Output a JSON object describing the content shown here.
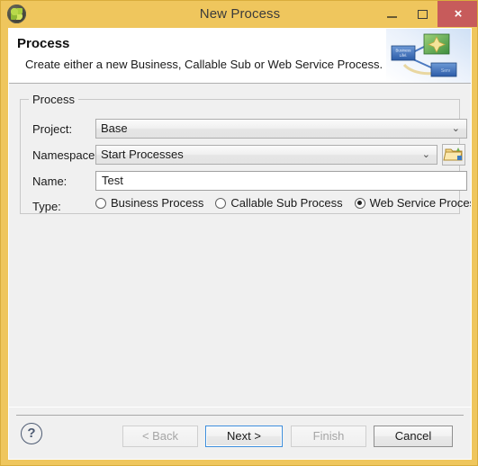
{
  "window": {
    "title": "New Process",
    "app_icon": "globe-clover-icon",
    "accent_border": "#efc65d",
    "close_button_color": "#c75b5b",
    "controls": {
      "minimize": "minimize-icon",
      "maximize": "maximize-icon",
      "close": "close-icon",
      "close_glyph": "×"
    }
  },
  "header": {
    "title": "Process",
    "subtitle": "Create either a new Business, Callable Sub or Web Service Process.",
    "banner_icon": "process-diagram-banner"
  },
  "form": {
    "group_legend": "Process",
    "fields": {
      "project": {
        "label": "Project:",
        "value": "Base",
        "chevron": "⌄",
        "type": "combobox"
      },
      "namespace": {
        "label": "Namespace:",
        "value": "Start Processes",
        "chevron": "⌄",
        "type": "combobox",
        "browse_icon": "folder-browse-icon"
      },
      "name": {
        "label": "Name:",
        "value": "Test",
        "placeholder": "",
        "type": "textfield"
      },
      "type": {
        "label": "Type:",
        "options": [
          {
            "label": "Business Process",
            "selected": false
          },
          {
            "label": "Callable Sub Process",
            "selected": false
          },
          {
            "label": "Web Service Process",
            "selected": true
          }
        ]
      }
    }
  },
  "footer": {
    "help_glyph": "?",
    "help_name": "help-button",
    "buttons": [
      {
        "label": "< Back",
        "state": "disabled",
        "name": "back-button"
      },
      {
        "label": "Next >",
        "state": "default",
        "name": "next-button"
      },
      {
        "label": "Finish",
        "state": "disabled",
        "name": "finish-button"
      },
      {
        "label": "Cancel",
        "state": "normal",
        "name": "cancel-button"
      }
    ]
  }
}
